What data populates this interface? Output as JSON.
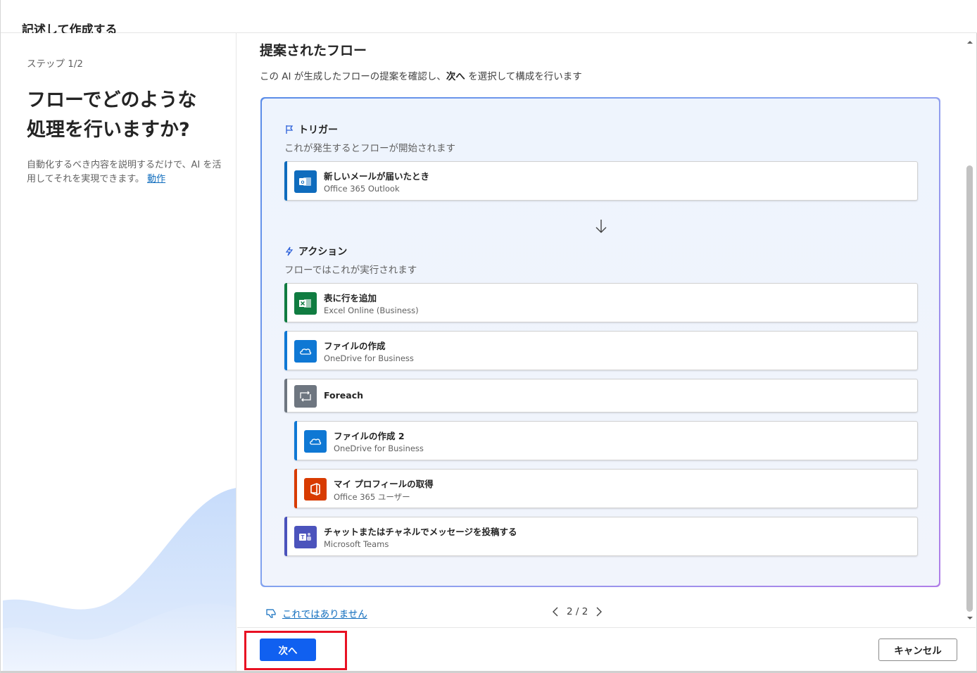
{
  "app": {
    "title": "記述して作成する"
  },
  "left": {
    "step": "ステップ 1/2",
    "heading_line1": "フローでどのような",
    "heading_line2": "処理を行いますか?",
    "desc_text": "自動化するべき内容を説明するだけで、AI を活用してそれを実現できます。",
    "desc_link": "動作"
  },
  "main": {
    "title": "提案されたフロー",
    "desc_pre": "この AI が生成したフローの提案を確認し、",
    "desc_bold": "次へ",
    "desc_post": " を選択して構成を行います",
    "trigger": {
      "heading": "トリガー",
      "sub": "これが発生するとフローが開始されます",
      "card": {
        "title": "新しいメールが届いたとき",
        "subtitle": "Office 365 Outlook",
        "icon": "outlook-icon",
        "color": "#0f6cbd"
      }
    },
    "actions": {
      "heading": "アクション",
      "sub": "フローではこれが実行されます",
      "items": [
        {
          "title": "表に行を追加",
          "subtitle": "Excel Online (Business)",
          "icon": "excel-icon",
          "color": "#107c41"
        },
        {
          "title": "ファイルの作成",
          "subtitle": "OneDrive for Business",
          "icon": "onedrive-icon",
          "color": "#0f78d4"
        },
        {
          "title": "Foreach",
          "subtitle": "",
          "icon": "loop-icon",
          "color": "#6e7680"
        },
        {
          "title": "ファイルの作成 2",
          "subtitle": "OneDrive for Business",
          "icon": "onedrive-icon",
          "color": "#0f78d4"
        },
        {
          "title": "マイ プロフィールの取得",
          "subtitle": "Office 365 ユーザー",
          "icon": "office-icon",
          "color": "#d83b01"
        },
        {
          "title": "チャットまたはチャネルでメッセージを投稿する",
          "subtitle": "Microsoft Teams",
          "icon": "teams-icon",
          "color": "#4b53bc"
        }
      ]
    },
    "not_this": "これではありません",
    "pager": "2 / 2"
  },
  "footer": {
    "next": "次へ",
    "cancel": "キャンセル"
  }
}
